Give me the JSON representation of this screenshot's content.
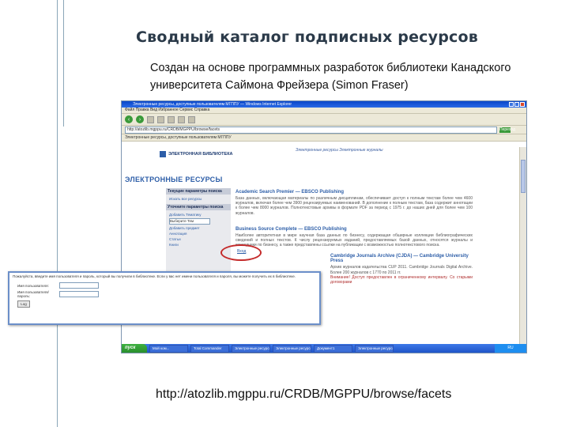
{
  "slide": {
    "title": "Сводный каталог подписных ресурсов",
    "subtitle": "Создан на основе программных разработок библиотеки Канадского университета Саймона Фрейзера (Simon Fraser)",
    "url": "http://atozlib.mgppu.ru/CRDB/MGPPU/browse/facets"
  },
  "browser": {
    "window_title": "Электронные ресурсы, доступные пользователям МГППУ — Windows Internet Explorer",
    "menu": "Файл  Правка  Вид  Избранное  Сервис  Справка",
    "address": "http://atozlib.mgppu.ru/CRDB/MGPPU/browse/facets",
    "go": "Переход",
    "links": "Электронные ресурсы, доступные пользователям МГППУ",
    "page": {
      "top_links": "Электронные ресурсы Электронные журналы",
      "banner": "ЭЛЕКТРОННАЯ БИБЛИОТЕКА",
      "section_title": "ЭЛЕКТРОННЫЕ РЕСУРСЫ",
      "sidebar": {
        "head1": "Текущие параметры поиска",
        "item1": "Искать все ресурсы",
        "head2": "Уточните параметры поиска",
        "item2": "Добавить Тематику",
        "select": "Выберите Тем",
        "item3": "Добавить предмет",
        "item4": "Аннотация",
        "item5": "Статьи",
        "item6": "Книги"
      },
      "resource1_title": "Academic Search Premier — EBSCO Publishing",
      "resource1_text": "База данных, включающая материалы по различным дисциплинам, обеспечивает доступ к полным текстам более чем 4600 журналов, включая более чем 3900 рецензируемых наименований. В дополнение к полным текстам, база содержит аннотации к более чем 8000 журналов. Полнотекстовые архивы в формате PDF за период с 1975 г. до наших дней для более чем 100 журналов.",
      "login_link": "Вход",
      "resource2_title": "Business Source Complete — EBSCO Publishing",
      "resource2_text": "Наиболее авторитетная в мире научная база данных по бизнесу, содержащая обширные коллекции библиографических сведений и полных текстов. К числу рецензируемых изданий, предоставляемых базой данных, относятся журналы и ежегодники по бизнесу, а также представлены ссылки на публикации с возможностью полнотекстового поиска.",
      "resource3_title": "Cambridge Journals Archive (CJDA) — Cambridge University Press",
      "resource3_text": "Архив журналов издательства CUP 2011. Cambridge Journals Digital Archive. Более 200 журналов с 1770 по 2011 гг.",
      "resource3_note": "Внимание! Доступ предоставлен в ограниченному интервалу. Со старыми договорами"
    },
    "taskbar": {
      "start": "пуск",
      "tasks": [
        "Мой ком...",
        "Total Commander",
        "Электронные ресурсы",
        "Электронные ресурсы",
        "Документ1",
        "Электронные ресурсы"
      ],
      "tray": "RU"
    }
  },
  "overlay": {
    "message": "Пожалуйста, введите имя пользователя и пароль, который вы получили в библиотеке. Если у вас нет имени пользователя и пароля, вы можете получить их в библиотеке.",
    "user_label": "Имя пользователя:",
    "pass_label": "Имя пользователя/пароль:",
    "button": "Log"
  }
}
